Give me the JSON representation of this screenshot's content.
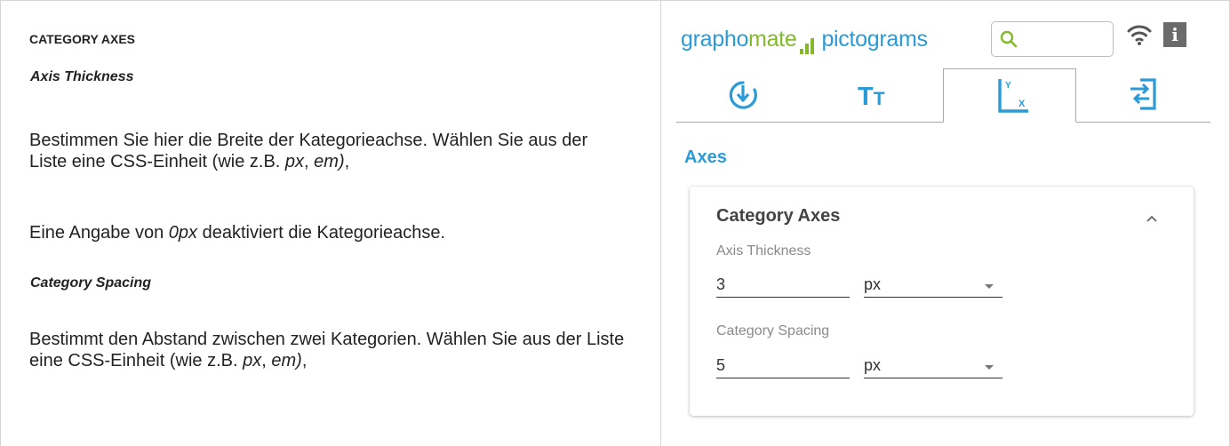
{
  "doc": {
    "heading": "CATEGORY AXES",
    "sections": [
      {
        "subheading": "Axis Thickness",
        "p1": {
          "before": "Bestimmen Sie hier die Breite der Kategorieachse. Wählen Sie aus der Liste eine CSS-Einheit (wie z.B. ",
          "em1": "px",
          "mid": ", ",
          "em2": "em)",
          "after": ","
        },
        "p2": {
          "before": "Eine Angabe von ",
          "em": "0px",
          "after": " deaktiviert die Kategorieachse."
        }
      },
      {
        "subheading": "Category Spacing",
        "p1": {
          "before": "Bestimmt den Abstand zwischen zwei Kategorien. Wählen Sie aus der Liste eine CSS-Einheit (wie z.B. ",
          "em1": "px",
          "mid": ", ",
          "em2": "em)",
          "after": ","
        }
      }
    ]
  },
  "panel": {
    "brand": {
      "part1": "grapho",
      "part2": "mate",
      "part3": "pictograms"
    },
    "search": {
      "value": "",
      "placeholder": ""
    },
    "info_label": "i",
    "tabs": [
      {
        "icon": "download-circle-icon",
        "active": false
      },
      {
        "icon": "text-size-icon",
        "label_big": "T",
        "label_small": "T",
        "active": false
      },
      {
        "icon": "axes-icon",
        "y_label": "Y",
        "x_label": "X",
        "active": true
      },
      {
        "icon": "exit-panel-icon",
        "active": false
      }
    ],
    "section_title": "Axes",
    "card": {
      "title": "Category Axes",
      "fields": [
        {
          "label": "Axis Thickness",
          "value": "3",
          "unit": "px"
        },
        {
          "label": "Category Spacing",
          "value": "5",
          "unit": "px"
        }
      ]
    }
  },
  "colors": {
    "brand_blue": "#2a9bd6",
    "brand_green": "#84b92e",
    "divider": "#d6d6d6",
    "info_bg": "#6b6b6b"
  }
}
